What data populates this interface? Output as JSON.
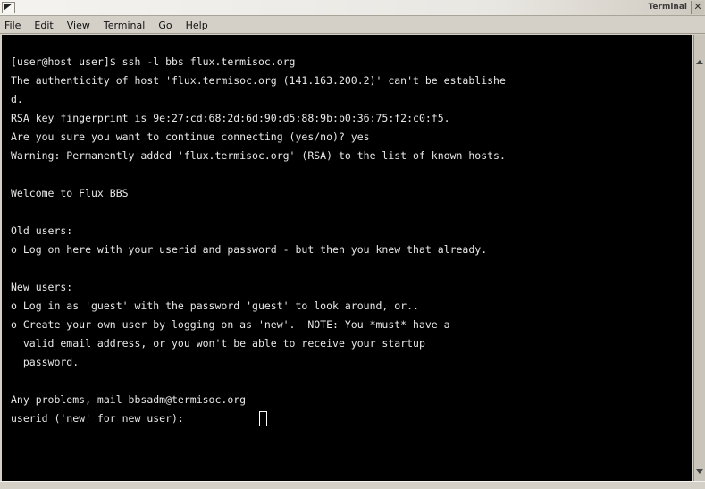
{
  "window": {
    "title": "Terminal",
    "close_glyph": "✕"
  },
  "menubar": {
    "items": [
      "File",
      "Edit",
      "View",
      "Terminal",
      "Go",
      "Help"
    ]
  },
  "terminal": {
    "lines": [
      "[user@host user]$ ssh -l bbs flux.termisoc.org",
      "The authenticity of host 'flux.termisoc.org (141.163.200.2)' can't be establishe",
      "d.",
      "RSA key fingerprint is 9e:27:cd:68:2d:6d:90:d5:88:9b:b0:36:75:f2:c0:f5.",
      "Are you sure you want to continue connecting (yes/no)? yes",
      "Warning: Permanently added 'flux.termisoc.org' (RSA) to the list of known hosts.",
      "",
      "Welcome to Flux BBS",
      "",
      "Old users:",
      "o Log on here with your userid and password - but then you knew that already.",
      "",
      "New users:",
      "o Log in as 'guest' with the password 'guest' to look around, or..",
      "o Create your own user by logging on as 'new'.  NOTE: You *must* have a",
      "  valid email address, or you won't be able to receive your startup",
      "  password.",
      "",
      "Any problems, mail bbsadm@termisoc.org",
      "userid ('new' for new user): "
    ]
  },
  "colors": {
    "terminal_bg": "#000000",
    "terminal_fg": "#e8e8e8",
    "chrome": "#d4d0c8"
  },
  "icons": {
    "window_menu": "window-menu-icon",
    "close": "close-icon",
    "scroll_up": "scroll-up-arrow-icon",
    "scroll_down": "scroll-down-arrow-icon"
  }
}
